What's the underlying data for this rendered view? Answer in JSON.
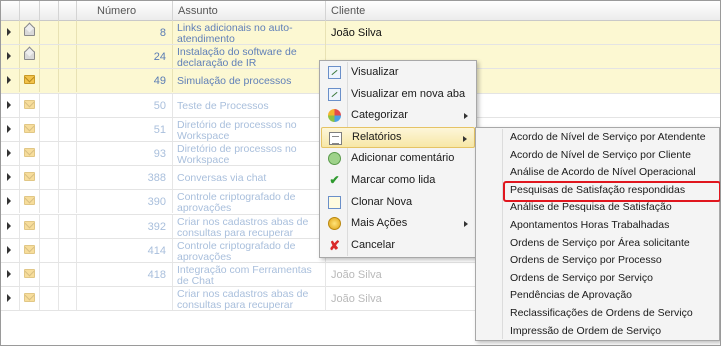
{
  "columns": {
    "numero": "Número",
    "assunto": "Assunto",
    "cliente": "Cliente"
  },
  "rows": [
    {
      "numero": "8",
      "assunto": "Links adicionais no auto-atendimento",
      "cliente": "João Silva",
      "status": "selected",
      "envelope": "open-envelope-icon"
    },
    {
      "numero": "24",
      "assunto": "Instalação do software de declaração de IR",
      "cliente": "",
      "status": "selected",
      "envelope": "open-envelope-icon"
    },
    {
      "numero": "49",
      "assunto": "Simulação de processos",
      "cliente": "",
      "status": "selected",
      "envelope": "closed-envelope-icon"
    },
    {
      "numero": "50",
      "assunto": "Teste de Processos",
      "cliente": "",
      "status": "faded",
      "envelope": "closed-envelope-icon"
    },
    {
      "numero": "51",
      "assunto": "Diretório de processos no Workspace",
      "cliente": "",
      "status": "faded",
      "envelope": "closed-envelope-icon"
    },
    {
      "numero": "93",
      "assunto": "Diretório de processos no Workspace",
      "cliente": "",
      "status": "faded",
      "envelope": "closed-envelope-icon"
    },
    {
      "numero": "388",
      "assunto": "Conversas via chat",
      "cliente": "",
      "status": "faded",
      "envelope": "closed-envelope-icon"
    },
    {
      "numero": "390",
      "assunto": "Controle criptografado de aprovações",
      "cliente": "",
      "status": "faded",
      "envelope": "closed-envelope-icon"
    },
    {
      "numero": "392",
      "assunto": "Criar nos cadastros abas de consultas para recuperar registros relacionados",
      "cliente": "",
      "status": "faded",
      "envelope": "closed-envelope-icon"
    },
    {
      "numero": "414",
      "assunto": "Controle criptografado de aprovações",
      "cliente": "João Silva",
      "status": "faded",
      "envelope": "closed-envelope-icon"
    },
    {
      "numero": "418",
      "assunto": "Integração com Ferramentas de Chat",
      "cliente": "João Silva",
      "status": "faded",
      "envelope": "closed-envelope-icon"
    },
    {
      "numero": "",
      "assunto": "Criar nos cadastros abas de consultas para recuperar",
      "cliente": "João Silva",
      "status": "faded",
      "envelope": "closed-envelope-icon"
    }
  ],
  "context_menu": {
    "items": [
      {
        "label": "Visualizar",
        "icon": "view-icon"
      },
      {
        "label": "Visualizar em nova aba",
        "icon": "new-tab-icon"
      },
      {
        "label": "Categorizar",
        "icon": "categorize-icon",
        "submenu": true
      },
      {
        "label": "Relatórios",
        "icon": "reports-icon",
        "submenu": true,
        "highlighted": true
      },
      {
        "label": "Adicionar comentário",
        "icon": "comment-icon"
      },
      {
        "label": "Marcar como lida",
        "icon": "checkmark-icon"
      },
      {
        "label": "Clonar Nova",
        "icon": "clone-icon"
      },
      {
        "label": "Mais Ações",
        "icon": "more-actions-icon",
        "submenu": true
      },
      {
        "label": "Cancelar",
        "icon": "cancel-icon"
      }
    ]
  },
  "reports_submenu": {
    "items": [
      "Acordo de Nível de Serviço por Atendente",
      "Acordo de Nível de Serviço por Cliente",
      "Análise de Acordo de Nível Operacional",
      "Pesquisas de Satisfação respondidas",
      "Análise de Pesquisa de Satisfação",
      "Apontamentos Horas Trabalhadas",
      "Ordens de Serviço por Área solicitante",
      "Ordens de Serviço por Processo",
      "Ordens de Serviço por Serviço",
      "Pendências de Aprovação",
      "Reclassificações de Ordens de Serviço",
      "Impressão de Ordem de Serviço"
    ],
    "highlighted_index": 3,
    "highlight_color": "#e0161e"
  },
  "colors": {
    "selected_row": "#fcf8d2",
    "link_text": "#7b98c7",
    "menu_highlight": "#f7e7a6"
  }
}
